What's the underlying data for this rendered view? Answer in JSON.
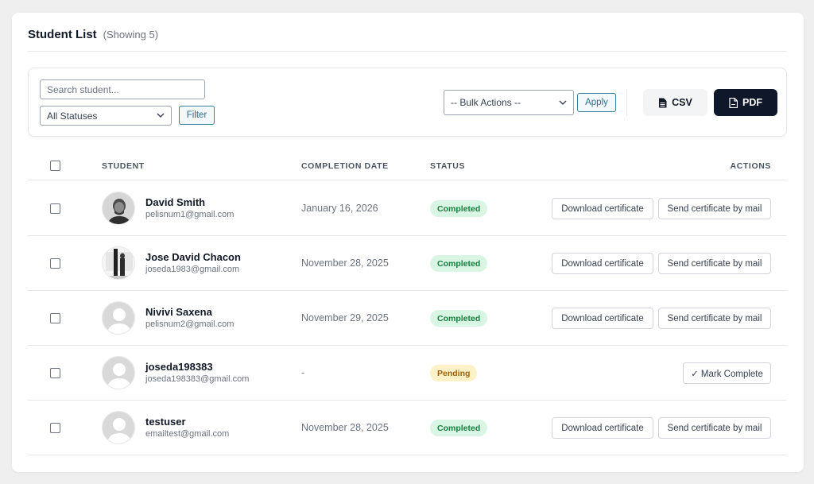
{
  "header": {
    "title": "Student List",
    "showing": "(Showing 5)"
  },
  "toolbar": {
    "search_placeholder": "Search student...",
    "status_filter_value": "All Statuses",
    "filter_label": "Filter",
    "bulk_actions_value": "-- Bulk Actions --",
    "apply_label": "Apply",
    "csv_label": "CSV",
    "pdf_label": "PDF"
  },
  "table": {
    "columns": {
      "student": "STUDENT",
      "completion_date": "COMPLETION DATE",
      "status": "STATUS",
      "actions": "ACTIONS"
    },
    "actions": {
      "download": "Download certificate",
      "send": "Send certificate by mail",
      "mark_complete": "✓ Mark Complete"
    },
    "rows": [
      {
        "name": "David Smith",
        "email": "pelisnum1@gmail.com",
        "date": "January 16, 2026",
        "status": "Completed",
        "avatar": "photo-man-beard-icon"
      },
      {
        "name": "Jose David Chacon",
        "email": "joseda1983@gmail.com",
        "date": "November 28, 2025",
        "status": "Completed",
        "avatar": "photo-person-window-icon"
      },
      {
        "name": "Nivivi Saxena",
        "email": "pelisnum2@gmail.com",
        "date": "November 29, 2025",
        "status": "Completed",
        "avatar": "default-avatar-icon"
      },
      {
        "name": "joseda198383",
        "email": "joseda198383@gmail.com",
        "date": "-",
        "status": "Pending",
        "avatar": "default-avatar-icon"
      },
      {
        "name": "testuser",
        "email": "emailtest@gmail.com",
        "date": "November 28, 2025",
        "status": "Completed",
        "avatar": "default-avatar-icon"
      }
    ]
  },
  "colors": {
    "completed_badge_bg": "#d9f5e3",
    "completed_badge_text": "#15803d",
    "pending_badge_bg": "#fdf1c7",
    "pending_badge_text": "#a16207",
    "pdf_button_bg": "#0f172a",
    "accent_button": "#2a6f90"
  }
}
